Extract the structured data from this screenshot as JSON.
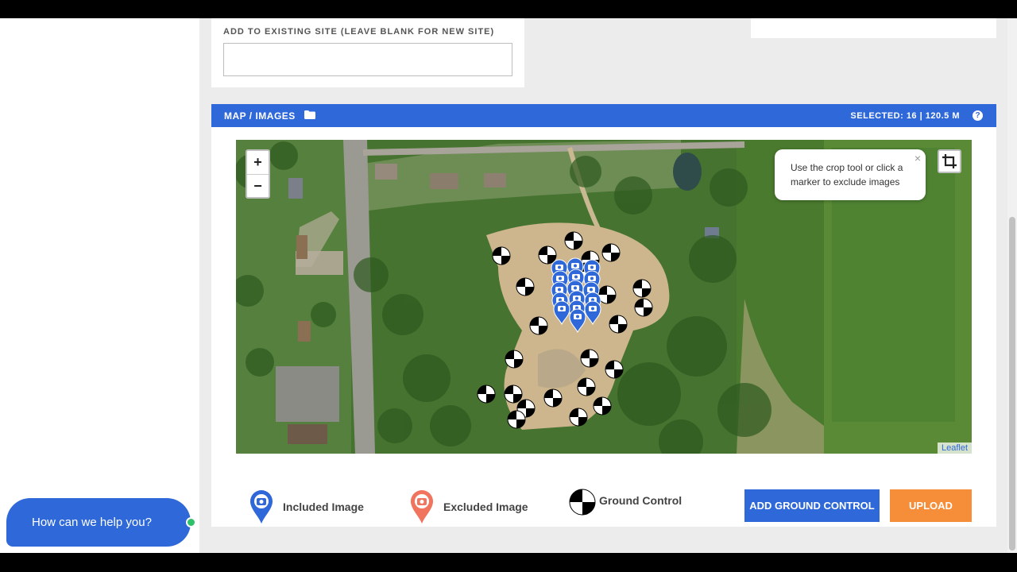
{
  "site": {
    "label": "ADD TO EXISTING SITE (LEAVE BLANK FOR NEW SITE)",
    "input_value": ""
  },
  "map_panel": {
    "title": "MAP / IMAGES",
    "title_icon": "folder-icon",
    "selected": "SELECTED: 16 | 120.5 M",
    "help_icon": "question-circle-icon",
    "zoom_in": "+",
    "zoom_out": "−",
    "tooltip_text": "Use the crop tool or click a marker to exclude images",
    "tooltip_close": "×",
    "attribution": "Leaflet",
    "included_marker_count": 16
  },
  "legend": {
    "included": "Included Image",
    "excluded": "Excluded Image",
    "ground_control": "Ground Control"
  },
  "buttons": {
    "add_ground_control": "ADD GROUND CONTROL",
    "upload": "UPLOAD"
  },
  "chat": {
    "label": "How can we help you?"
  },
  "colors": {
    "primary": "#2f68d8",
    "accent": "#f68d38",
    "excluded_marker": "#f0745e",
    "online": "#2ec06a"
  }
}
